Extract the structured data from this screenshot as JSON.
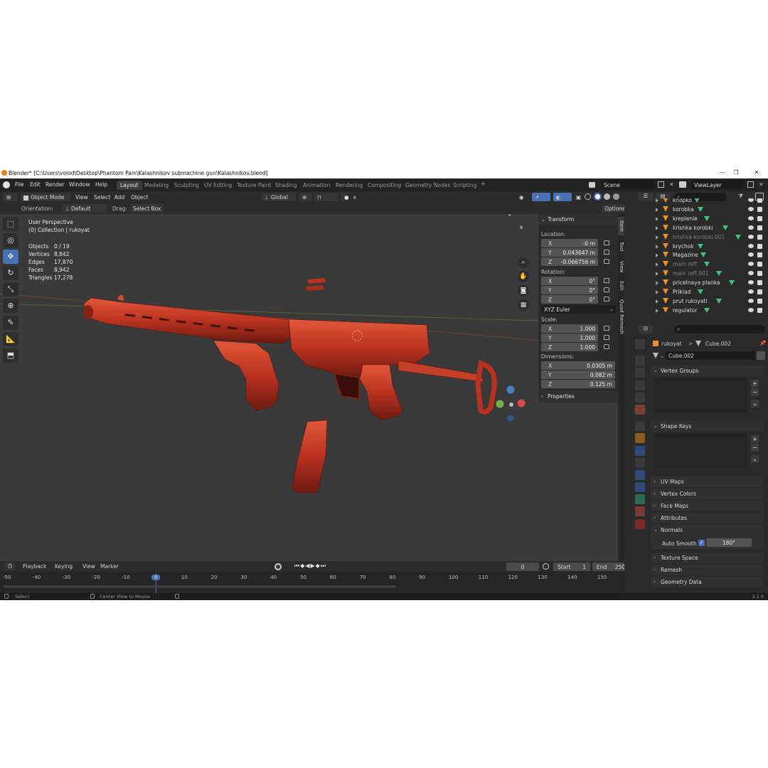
{
  "window": {
    "title": "Blender* [C:\\Users\\volod\\Desktop\\Phantom Pain\\Kalashnikov submachine gun\\Kalashnikov.blend]",
    "controls": [
      "—",
      "❐",
      "✕"
    ]
  },
  "menu": {
    "items": [
      "File",
      "Edit",
      "Render",
      "Window",
      "Help"
    ],
    "workspaces": [
      "Layout",
      "Modeling",
      "Sculpting",
      "UV Editing",
      "Texture Paint",
      "Shading",
      "Animation",
      "Rendering",
      "Compositing",
      "Geometry Nodes",
      "Scripting"
    ],
    "active_workspace": "Layout",
    "add_tab": "+",
    "scene": "Scene",
    "view_layer": "ViewLayer"
  },
  "header": {
    "mode": "Object Mode",
    "menus": [
      "View",
      "Select",
      "Add",
      "Object"
    ],
    "transform_orientation": "Global",
    "orientation_label": "Orientation:",
    "orientation_value": "Default",
    "drag_label": "Drag:",
    "drag_value": "Select Box",
    "options": "Options"
  },
  "viewport": {
    "perspective": "User Perspective",
    "collection": "(0) Collection | rukoyat",
    "stats": [
      {
        "label": "Objects",
        "value": "0 / 19"
      },
      {
        "label": "Vertices",
        "value": "8,842"
      },
      {
        "label": "Edges",
        "value": "17,870"
      },
      {
        "label": "Faces",
        "value": "8,942"
      },
      {
        "label": "Triangles",
        "value": "17,278"
      }
    ],
    "gizmo": {
      "x": "X",
      "y": "Y",
      "z": "Z"
    },
    "model_color": "#b8321f",
    "background_color": "#3a3a3a"
  },
  "toolbar": {
    "tools": [
      "select-box-icon",
      "cursor-icon",
      "move-icon",
      "rotate-icon",
      "scale-icon",
      "transform-icon",
      "annotate-icon",
      "measure-icon",
      "add-cube-icon"
    ],
    "active": "move-icon"
  },
  "npanel": {
    "title": "Transform",
    "location_label": "Location:",
    "location": [
      {
        "axis": "X",
        "value": "-0 m"
      },
      {
        "axis": "Y",
        "value": "0.043647 m"
      },
      {
        "axis": "Z",
        "value": "-0.066756 m"
      }
    ],
    "rotation_label": "Rotation:",
    "rotation": [
      {
        "axis": "X",
        "value": "0°"
      },
      {
        "axis": "Y",
        "value": "0°"
      },
      {
        "axis": "Z",
        "value": "0°"
      }
    ],
    "rotation_mode": "XYZ Euler",
    "scale_label": "Scale:",
    "scale": [
      {
        "axis": "X",
        "value": "1.000"
      },
      {
        "axis": "Y",
        "value": "1.000"
      },
      {
        "axis": "Z",
        "value": "1.000"
      }
    ],
    "dimensions_label": "Dimensions:",
    "dimensions": [
      {
        "axis": "X",
        "value": "0.0305 m"
      },
      {
        "axis": "Y",
        "value": "0.082 m"
      },
      {
        "axis": "Z",
        "value": "0.125 m"
      }
    ],
    "properties": "Properties",
    "side_tabs": [
      "Item",
      "Tool",
      "View",
      "Edit",
      "Quad Remesh"
    ]
  },
  "timeline": {
    "menus": [
      "Playback",
      "Keying",
      "View",
      "Marker"
    ],
    "current_frame": "0",
    "start_label": "Start",
    "start": "1",
    "end_label": "End",
    "end": "250",
    "ticks": [
      "-50",
      "-40",
      "-30",
      "-20",
      "-10",
      "0",
      "10",
      "20",
      "30",
      "40",
      "50",
      "60",
      "70",
      "80",
      "90",
      "100",
      "110",
      "120",
      "130",
      "140",
      "150"
    ]
  },
  "statusbar": {
    "select": "Select",
    "center": "Center View to Mouse",
    "version": "3.1.0"
  },
  "outliner": {
    "items": [
      {
        "name": "knopko",
        "dim": false
      },
      {
        "name": "korobka",
        "dim": false
      },
      {
        "name": "kreplenie",
        "dim": false
      },
      {
        "name": "krishka korobki",
        "dim": false
      },
      {
        "name": "krishka korobki.001",
        "dim": true
      },
      {
        "name": "krychok",
        "dim": false
      },
      {
        "name": "Magazine",
        "dim": false
      },
      {
        "name": "main reff",
        "dim": true
      },
      {
        "name": "main reff.001",
        "dim": true
      },
      {
        "name": "pricelnaya planka",
        "dim": false
      },
      {
        "name": "Priklad",
        "dim": false
      },
      {
        "name": "prut rukoyati",
        "dim": false
      },
      {
        "name": "regulator",
        "dim": false
      }
    ]
  },
  "properties": {
    "breadcrumb_object": "rukoyat",
    "breadcrumb_separator": ">",
    "breadcrumb_mesh": "Cube.002",
    "mesh_name": "Cube.002",
    "sections": {
      "vertex_groups": "Vertex Groups",
      "shape_keys": "Shape Keys",
      "uv_maps": "UV Maps",
      "vertex_colors": "Vertex Colors",
      "face_maps": "Face Maps",
      "attributes": "Attributes",
      "normals": "Normals",
      "auto_smooth": "Auto Smooth",
      "auto_smooth_angle": "180°",
      "texture_space": "Texture Space",
      "remesh": "Remesh",
      "geometry_data": "Geometry Data"
    }
  }
}
